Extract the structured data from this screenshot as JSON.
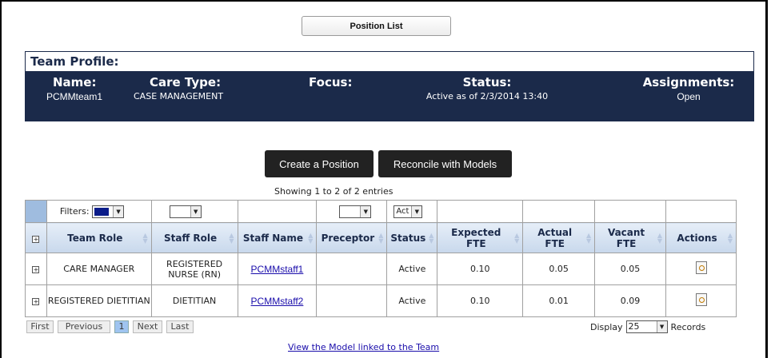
{
  "toolbar": {
    "position_list_label": "Position List"
  },
  "team_profile": {
    "title": "Team Profile:",
    "name_label": "Name:",
    "name_value": "PCMMteam1",
    "care_type_label": "Care Type:",
    "care_type_value": "CASE MANAGEMENT",
    "focus_label": "Focus:",
    "focus_value": "",
    "status_label": "Status:",
    "status_value": "Active as of 2/3/2014 13:40",
    "assignments_label": "Assignments:",
    "assignments_value": "Open"
  },
  "actions": {
    "create_label": "Create a Position",
    "reconcile_label": "Reconcile with Models"
  },
  "table": {
    "showing_text": "Showing 1 to 2 of 2 entries",
    "filters_label": "Filters:",
    "status_filter_value": "Act",
    "headers": {
      "team_role": "Team Role",
      "staff_role": "Staff Role",
      "staff_name": "Staff Name",
      "preceptor": "Preceptor",
      "status": "Status",
      "expected_fte": "Expected FTE",
      "actual_fte": "Actual FTE",
      "vacant_fte": "Vacant FTE",
      "actions": "Actions"
    },
    "rows": [
      {
        "team_role": "CARE MANAGER",
        "staff_role": "REGISTERED NURSE (RN)",
        "staff_name": "PCMMstaff1",
        "preceptor": "",
        "status": "Active",
        "expected_fte": "0.10",
        "actual_fte": "0.05",
        "vacant_fte": "0.05"
      },
      {
        "team_role": "REGISTERED DIETITIAN",
        "staff_role": "DIETITIAN",
        "staff_name": "PCMMstaff2",
        "preceptor": "",
        "status": "Active",
        "expected_fte": "0.10",
        "actual_fte": "0.01",
        "vacant_fte": "0.09"
      }
    ]
  },
  "pager": {
    "first": "First",
    "previous": "Previous",
    "page": "1",
    "next": "Next",
    "last": "Last"
  },
  "display": {
    "prefix": "Display",
    "value": "25",
    "suffix": "Records"
  },
  "footer": {
    "model_link": "View the Model linked to the Team"
  },
  "colors": {
    "navy": "#1b2a4a",
    "header_blue": "#c8d8ec",
    "active_page": "#9fc4f0"
  }
}
